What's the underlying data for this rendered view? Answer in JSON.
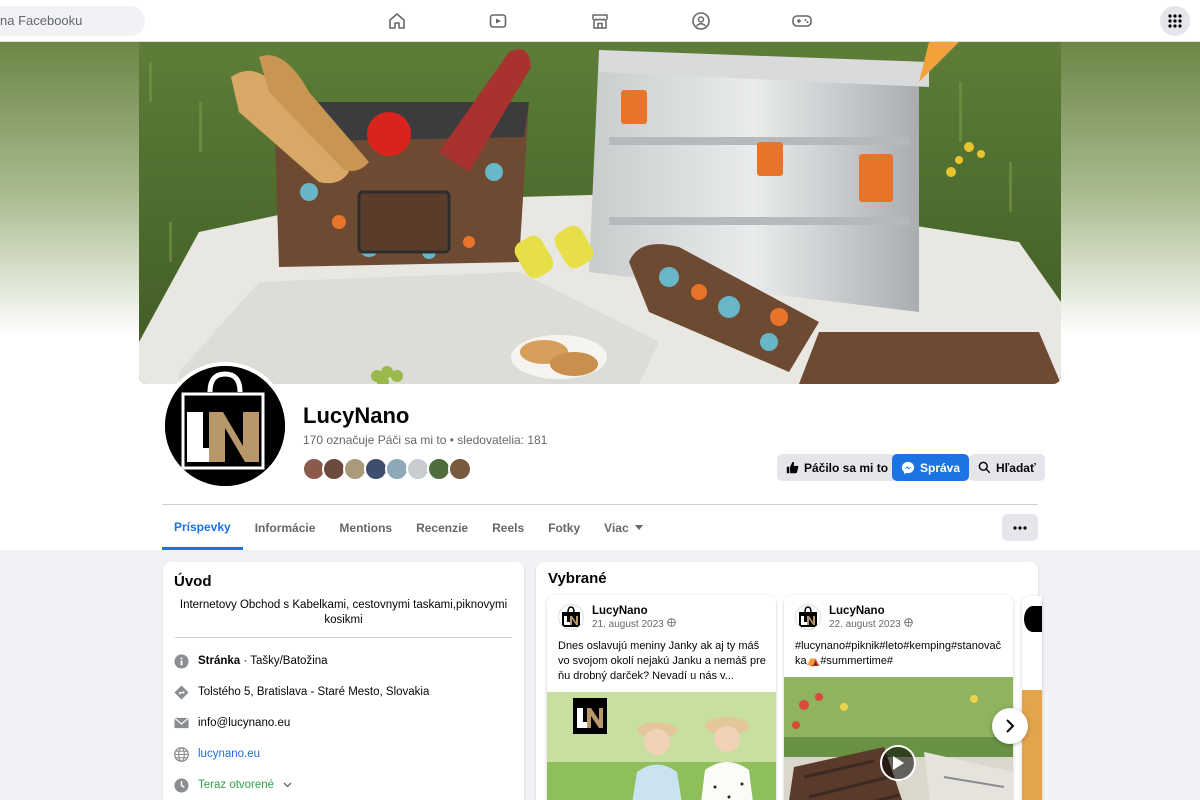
{
  "topbar": {
    "search_placeholder": "na Facebooku",
    "nav_icons": [
      "home-icon",
      "watch-icon",
      "marketplace-icon",
      "groups-icon",
      "gaming-icon"
    ],
    "menu_icon": "grid-menu-icon"
  },
  "page": {
    "name": "LucyNano",
    "stats": "170 označuje Páči sa mi to • sledovatelia: 181",
    "logo_text": "LN",
    "follower_avatar_count": 8
  },
  "actions": {
    "like": "Páčilo sa mi to",
    "message": "Správa",
    "search": "Hľadať"
  },
  "tabs": [
    "Príspevky",
    "Informácie",
    "Mentions",
    "Recenzie",
    "Reels",
    "Fotky",
    "Viac"
  ],
  "intro": {
    "title": "Úvod",
    "description": "Internetovy Obchod s Kabelkami, cestovnymi taskami,piknovymi kosikmi",
    "category_label": "Stránka",
    "category": " · Tašky/Batožina",
    "address": "Tolstého 5, Bratislava - Staré Mesto, Slovakia",
    "email": "info@lucynano.eu",
    "website": "lucynano.eu",
    "hours": "Teraz otvorené"
  },
  "featured": {
    "title": "Vybrané",
    "posts": [
      {
        "author": "LucyNano",
        "date": "21. august 2023",
        "text": "Dnes oslavujú meniny Janky ak aj ty máš vo svojom okolí nejakú Janku a nemáš pre ňu drobný darček? Nevadí u nás v..."
      },
      {
        "author": "LucyNano",
        "date": "22. august 2023",
        "text": "#lucynano#piknik#leto#kemping#stanovačka⛺#summertime#"
      }
    ]
  },
  "colors": {
    "accent": "#1b74e4",
    "link": "#216fdb",
    "open_green": "#31a24c",
    "logo_gold": "#b8976a"
  }
}
